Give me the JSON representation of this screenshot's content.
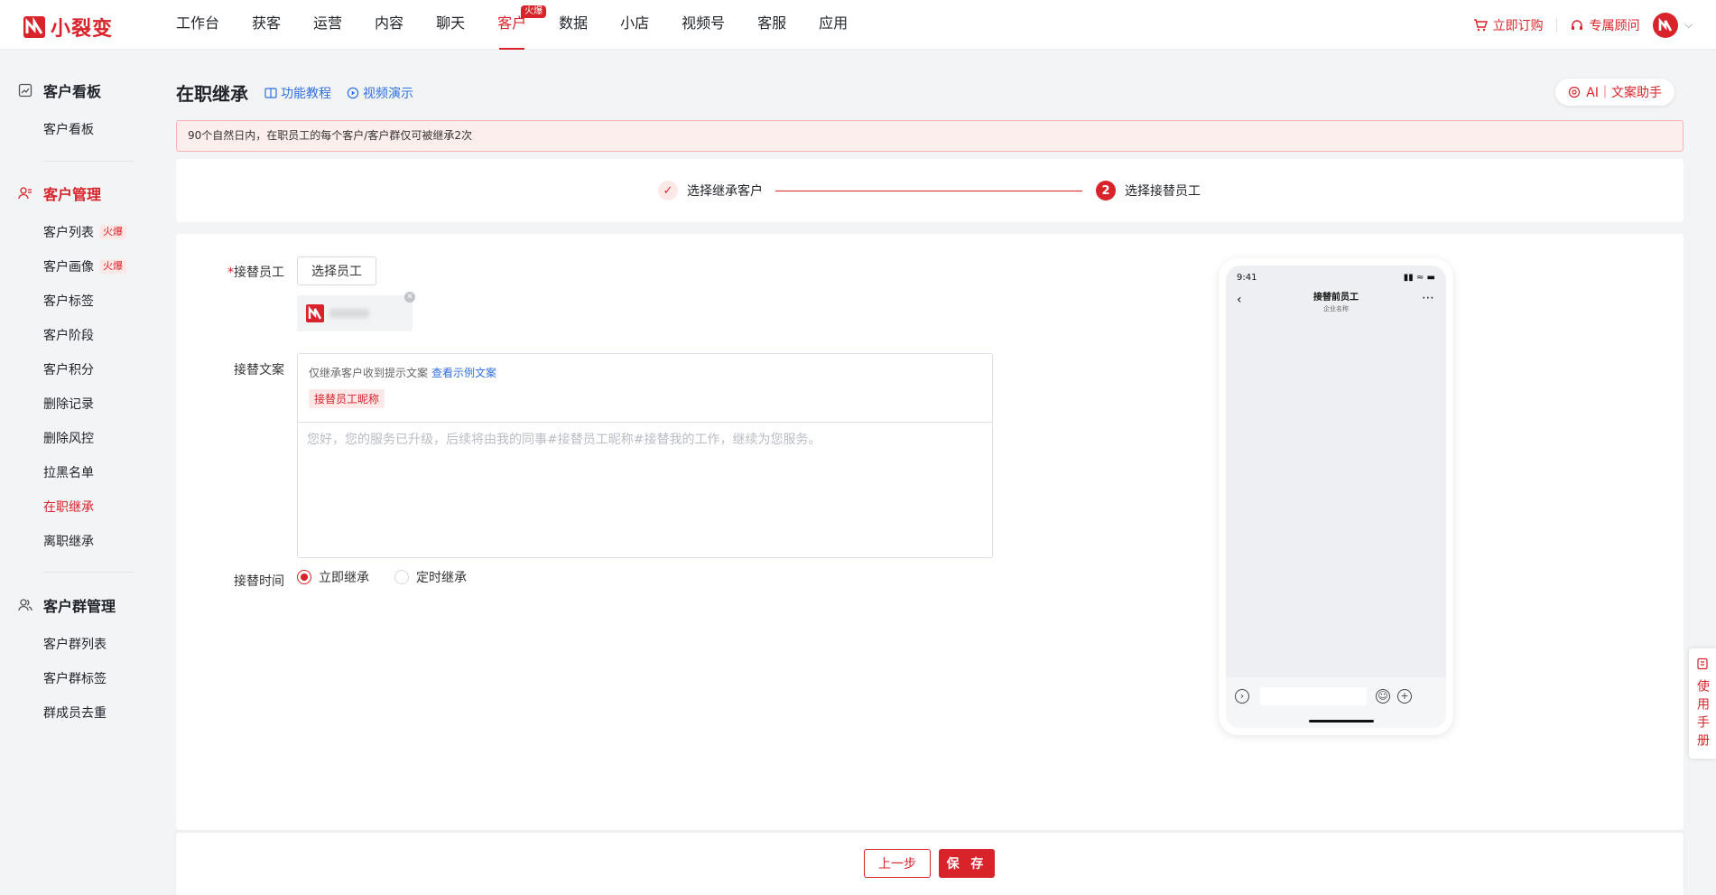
{
  "brand": {
    "name": "小裂变",
    "color": "#d8232a"
  },
  "nav": {
    "items": [
      {
        "label": "工作台"
      },
      {
        "label": "获客"
      },
      {
        "label": "运营"
      },
      {
        "label": "内容"
      },
      {
        "label": "聊天"
      },
      {
        "label": "客户",
        "badge": "火爆",
        "active": true
      },
      {
        "label": "数据"
      },
      {
        "label": "小店"
      },
      {
        "label": "视频号"
      },
      {
        "label": "客服"
      },
      {
        "label": "应用"
      }
    ],
    "order_label": "立即订购",
    "consultant_label": "专属顾问"
  },
  "sidebar": {
    "groups": [
      {
        "title": "客户看板",
        "icon": "dashboard-icon",
        "items": [
          {
            "label": "客户看板"
          }
        ]
      },
      {
        "title": "客户管理",
        "icon": "user-manage-icon",
        "active": true,
        "items": [
          {
            "label": "客户列表",
            "badge": "火爆"
          },
          {
            "label": "客户画像",
            "badge": "火爆"
          },
          {
            "label": "客户标签"
          },
          {
            "label": "客户阶段"
          },
          {
            "label": "客户积分"
          },
          {
            "label": "删除记录"
          },
          {
            "label": "删除风控"
          },
          {
            "label": "拉黑名单"
          },
          {
            "label": "在职继承",
            "active": true
          },
          {
            "label": "离职继承"
          }
        ]
      },
      {
        "title": "客户群管理",
        "icon": "group-icon",
        "items": [
          {
            "label": "客户群列表"
          },
          {
            "label": "客户群标签"
          },
          {
            "label": "群成员去重"
          }
        ]
      }
    ]
  },
  "page": {
    "title": "在职继承",
    "tutorial_label": "功能教程",
    "video_label": "视频演示",
    "ai_label": "AI｜文案助手",
    "notice": "90个自然日内，在职员工的每个客户/客户群仅可被继承2次"
  },
  "steps": {
    "step1": "选择继承客户",
    "step2_num": "2",
    "step2": "选择接替员工"
  },
  "form": {
    "employee_label": "接替员工",
    "select_employee": "选择员工",
    "copy_label": "接替文案",
    "copy_hint": "仅继承客户收到提示文案",
    "copy_example": "查看示例文案",
    "variable_tag": "接替员工昵称",
    "copy_placeholder": "您好，您的服务已升级，后续将由我的同事#接替员工昵称#接替我的工作，继续为您服务。",
    "time_label": "接替时间",
    "time_options": [
      {
        "label": "立即继承",
        "selected": true
      },
      {
        "label": "定时继承",
        "selected": false
      }
    ]
  },
  "phone": {
    "time": "9:41",
    "title": "接替前员工",
    "subtitle": "企业名称"
  },
  "manual": {
    "label": "使用手册"
  },
  "footer": {
    "prev": "上一步",
    "save": "保 存"
  }
}
